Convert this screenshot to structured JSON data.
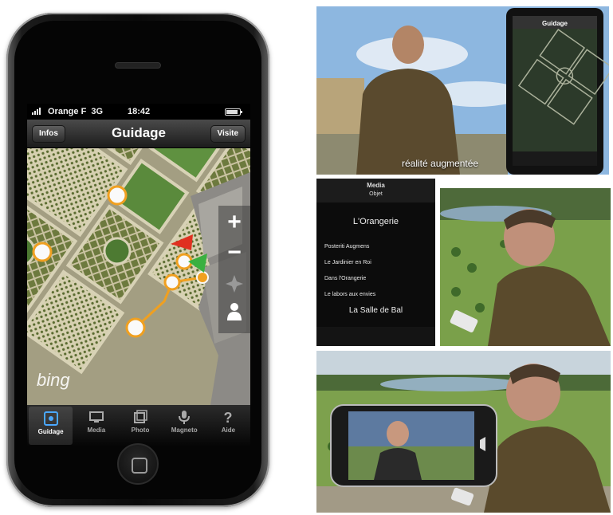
{
  "status_bar": {
    "carrier": "Orange F",
    "network": "3G",
    "time": "18:42"
  },
  "nav_bar": {
    "title": "Guidage",
    "left_button": "Infos",
    "right_button": "Visite"
  },
  "map": {
    "provider_logo": "bing",
    "zoom_in_label": "+",
    "zoom_out_label": "−"
  },
  "tab_bar": {
    "tabs": [
      {
        "label": "Guidage",
        "icon": "compass-icon",
        "active": true
      },
      {
        "label": "Media",
        "icon": "monitor-icon",
        "active": false
      },
      {
        "label": "Photo",
        "icon": "photo-icon",
        "active": false
      },
      {
        "label": "Magneto",
        "icon": "microphone-icon",
        "active": false
      },
      {
        "label": "Aide",
        "icon": "question-icon",
        "active": false
      }
    ]
  },
  "photo_top": {
    "caption": "réalité augmentée",
    "phone_title": "Guidage"
  },
  "photo_middle": {
    "menu_header": "Media",
    "menu_sub": "Objet",
    "section_title": "L'Orangerie",
    "items": [
      "Posteriti Augmens",
      "Le Jardinier en Roi",
      "Dans l'Orangerie",
      "Le labors aux envies"
    ],
    "footer": "La Salle de Bal"
  },
  "colors": {
    "accent_orange": "#f0a020",
    "flag_red": "#e03020",
    "flag_green": "#3ab040",
    "map_green": "#5c8a3a"
  }
}
